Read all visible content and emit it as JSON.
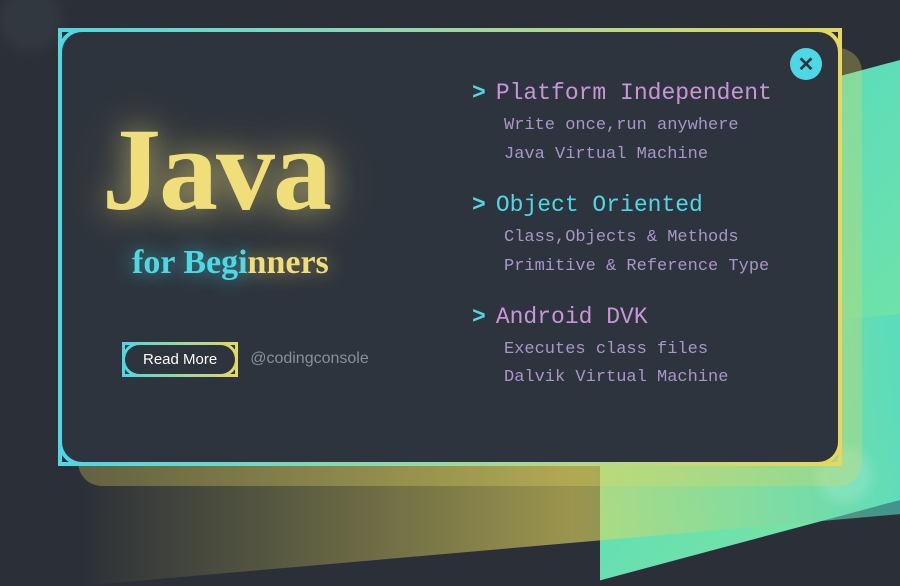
{
  "hero": {
    "title": "Java",
    "subtitle_for": "for ",
    "subtitle_begi": "Begi",
    "subtitle_nners": "nners"
  },
  "cta": {
    "readmore_label": "Read More",
    "handle": "@codingconsole"
  },
  "features": [
    {
      "chevron": ">",
      "title": "Platform Independent",
      "title_color": "pink",
      "lines": [
        "Write once,run anywhere",
        "Java Virtual Machine"
      ]
    },
    {
      "chevron": ">",
      "title": "Object Oriented",
      "title_color": "cyan",
      "lines": [
        "Class,Objects & Methods",
        "Primitive & Reference Type"
      ]
    },
    {
      "chevron": ">",
      "title": "Android DVK",
      "title_color": "pink",
      "lines": [
        "Executes class files",
        "Dalvik Virtual Machine"
      ]
    }
  ],
  "close_icon": "✕"
}
